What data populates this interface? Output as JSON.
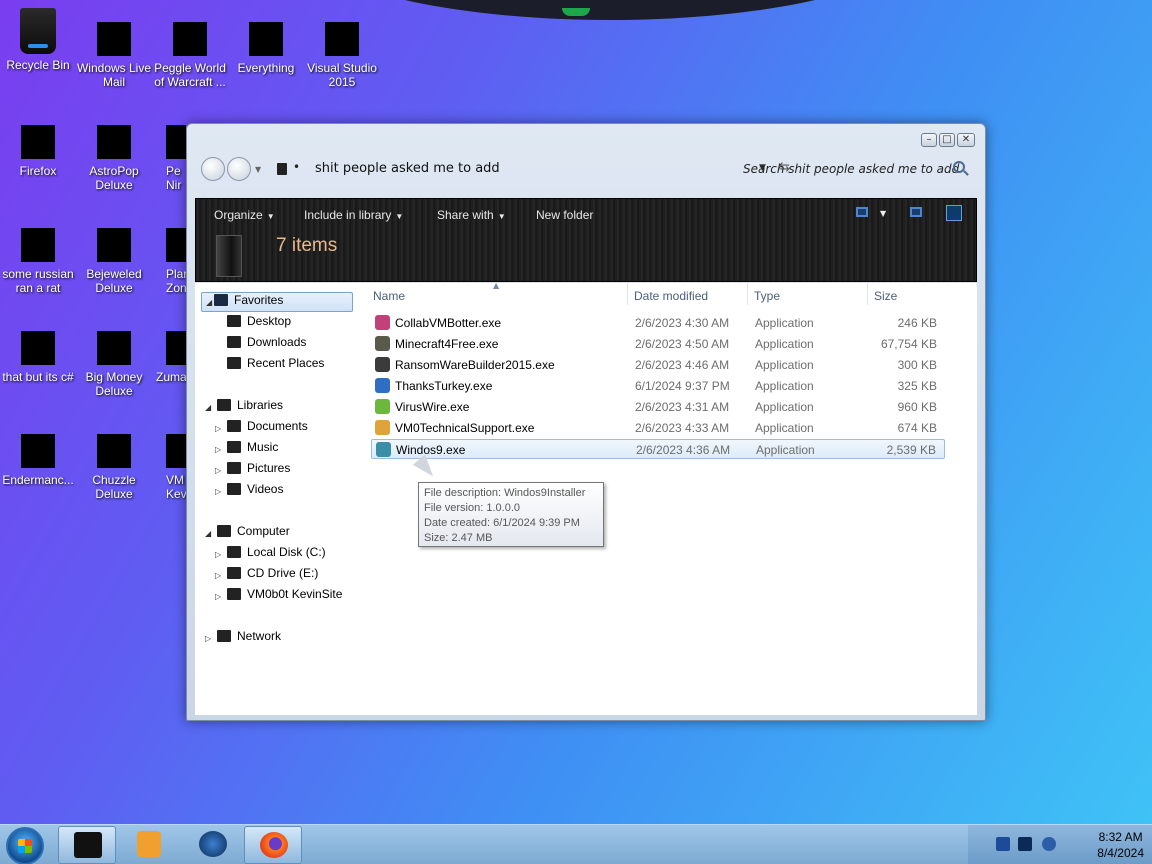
{
  "desktop_icons": [
    {
      "label": "Recycle Bin",
      "icon": "recycle-bin-icon"
    },
    {
      "label": "Windows Live Mail",
      "icon": "windows-live-mail-icon"
    },
    {
      "label": "Peggle World of Warcraft ...",
      "icon": "peggle-icon"
    },
    {
      "label": "Everything",
      "icon": "everything-icon"
    },
    {
      "label": "Visual Studio 2015",
      "icon": "visual-studio-icon"
    },
    {
      "label": "Firefox",
      "icon": "firefox-icon"
    },
    {
      "label": "AstroPop Deluxe",
      "icon": "astropop-icon"
    },
    {
      "label": "Pe Nir",
      "icon": "peggle-nights-icon"
    },
    {
      "label": "some russian ran a rat",
      "icon": "ie-icon"
    },
    {
      "label": "Bejeweled Deluxe",
      "icon": "bejeweled-icon"
    },
    {
      "label": "Plan Zon",
      "icon": "plants-vs-zombies-icon"
    },
    {
      "label": "that but its c#",
      "icon": "stack-icon"
    },
    {
      "label": "Big Money Deluxe",
      "icon": "big-money-icon"
    },
    {
      "label": "Zuma",
      "icon": "zuma-icon"
    },
    {
      "label": "Endermanc...",
      "icon": "endermanch-icon"
    },
    {
      "label": "Chuzzle Deluxe",
      "icon": "chuzzle-icon"
    },
    {
      "label": "VM Kev",
      "icon": "vm-icon"
    }
  ],
  "window": {
    "minimize": "–",
    "maximize": "□",
    "close": "✕",
    "address": "shit people asked me to add",
    "address_sep": "•",
    "search_placeholder": "Search shit people asked me to add",
    "toolbar": {
      "organize": "Organize",
      "include": "Include in library",
      "share": "Share with",
      "new_folder": "New folder",
      "dropdown_arrow": "▼"
    },
    "item_count": "7 items"
  },
  "nav": {
    "favorites": "Favorites",
    "desktop": "Desktop",
    "downloads": "Downloads",
    "recent": "Recent Places",
    "libraries": "Libraries",
    "documents": "Documents",
    "music": "Music",
    "pictures": "Pictures",
    "videos": "Videos",
    "computer": "Computer",
    "local_disk": "Local Disk (C:)",
    "cd_drive": "CD Drive (E:)",
    "kevinsite": "VM0b0t KevinSite",
    "network": "Network",
    "expanded": "◢",
    "collapsed": "▷"
  },
  "columns": {
    "name": "Name",
    "date": "Date modified",
    "type": "Type",
    "size": "Size"
  },
  "files": [
    {
      "name": "CollabVMBotter.exe",
      "date": "2/6/2023 4:30 AM",
      "type": "Application",
      "size": "246 KB",
      "color": "#c2417a"
    },
    {
      "name": "Minecraft4Free.exe",
      "date": "2/6/2023 4:50 AM",
      "type": "Application",
      "size": "67,754 KB",
      "color": "#5a5a4a"
    },
    {
      "name": "RansomWareBuilder2015.exe",
      "date": "2/6/2023 4:46 AM",
      "type": "Application",
      "size": "300 KB",
      "color": "#3b3b3b"
    },
    {
      "name": "ThanksTurkey.exe",
      "date": "6/1/2024 9:37 PM",
      "type": "Application",
      "size": "325 KB",
      "color": "#2e6fc4"
    },
    {
      "name": "VirusWire.exe",
      "date": "2/6/2023 4:31 AM",
      "type": "Application",
      "size": "960 KB",
      "color": "#6bb83c"
    },
    {
      "name": "VM0TechnicalSupport.exe",
      "date": "2/6/2023 4:33 AM",
      "type": "Application",
      "size": "674 KB",
      "color": "#e0a23a"
    },
    {
      "name": "Windos9.exe",
      "date": "2/6/2023 4:36 AM",
      "type": "Application",
      "size": "2,539 KB",
      "color": "#3a8fa6"
    }
  ],
  "tooltip": {
    "description": "File description: Windos9Installer",
    "version": "File version: 1.0.0.0",
    "created": "Date created: 6/1/2024 9:39 PM",
    "size": "Size: 2.47 MB"
  },
  "taskbar": {
    "time": "8:32 AM",
    "date": "8/4/2024"
  }
}
